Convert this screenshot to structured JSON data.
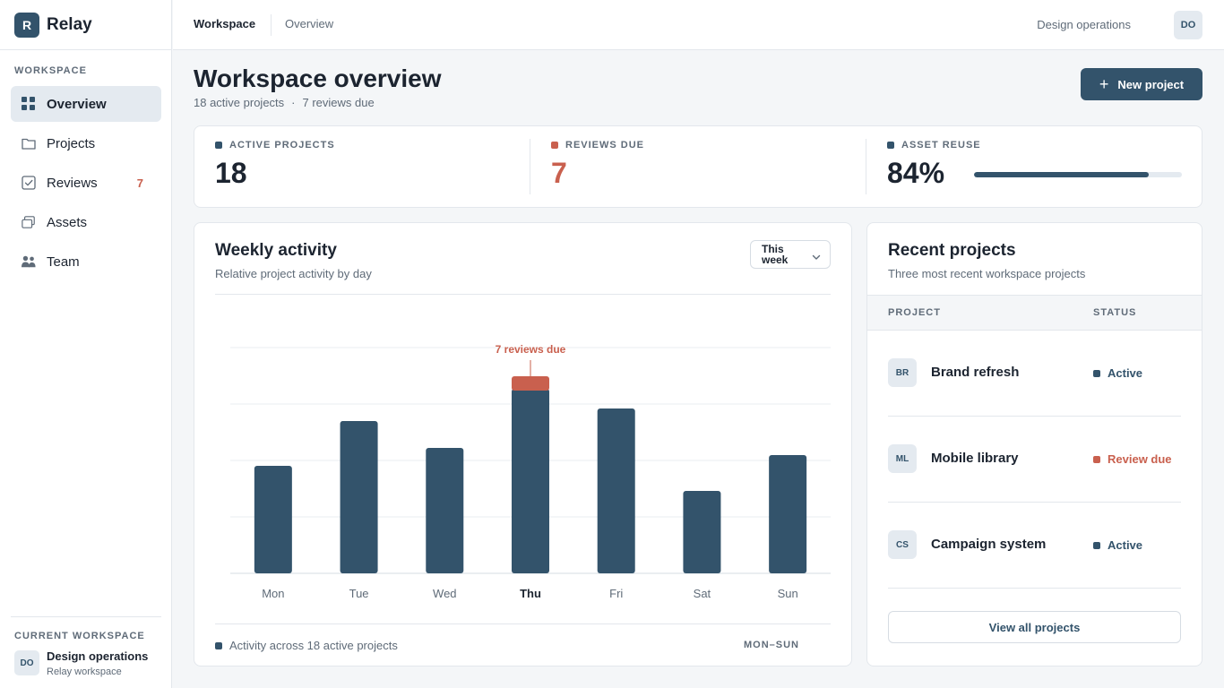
{
  "brand": {
    "logo_letter": "R",
    "name": "Relay"
  },
  "sidebar": {
    "section_label": "WORKSPACE",
    "items": [
      {
        "label": "Overview",
        "icon": "grid-icon",
        "active": true,
        "badge": ""
      },
      {
        "label": "Projects",
        "icon": "folder-icon",
        "active": false,
        "badge": ""
      },
      {
        "label": "Reviews",
        "icon": "checkbox-icon",
        "active": false,
        "badge": "7"
      },
      {
        "label": "Assets",
        "icon": "layers-icon",
        "active": false,
        "badge": ""
      },
      {
        "label": "Team",
        "icon": "people-icon",
        "active": false,
        "badge": ""
      }
    ],
    "current_workspace": {
      "label": "CURRENT WORKSPACE",
      "avatar": "DO",
      "name": "Design operations",
      "subtitle": "Relay workspace"
    }
  },
  "topbar": {
    "tabs": [
      "Workspace",
      "Overview"
    ],
    "org_name": "Design operations",
    "avatar": "DO"
  },
  "header": {
    "title": "Workspace overview",
    "subtitle_projects": "18 active projects",
    "subtitle_separator": "·",
    "subtitle_reviews": "7 reviews due",
    "new_project_label": "New project"
  },
  "stats": [
    {
      "label": "ACTIVE PROJECTS",
      "value": "18",
      "color": "#33536b"
    },
    {
      "label": "REVIEWS DUE",
      "value": "7",
      "color": "#c9604e"
    },
    {
      "label": "ASSET REUSE",
      "value": "84%",
      "color": "#33536b",
      "progress": 0.84
    }
  ],
  "activity": {
    "title": "Weekly activity",
    "subtitle": "Relative project activity by day",
    "range_select": "This week",
    "footer": "Activity across 18 active projects",
    "footer_range": "MON–SUN"
  },
  "chart_data": {
    "type": "bar",
    "categories": [
      "Mon",
      "Tue",
      "Wed",
      "Thu",
      "Fri",
      "Sat",
      "Sun"
    ],
    "series": [
      {
        "values": [
          60,
          85,
          70,
          103,
          92,
          46,
          66
        ],
        "color": "#33536b"
      },
      {
        "values": [
          0,
          0,
          0,
          7,
          0,
          0,
          0
        ],
        "color": "#c9604e"
      }
    ],
    "highlight_category": "Thu",
    "annotation": {
      "category": "Thu",
      "text": "7 reviews due",
      "color": "#c9604e"
    },
    "ylim": [
      0,
      126
    ],
    "grid": true
  },
  "recent": {
    "title": "Recent projects",
    "subtitle": "Three most recent workspace projects",
    "columns": [
      "PROJECT",
      "STATUS"
    ],
    "rows": [
      {
        "initials": "BR",
        "name": "Brand refresh",
        "status": "Active",
        "status_color": "#33536b"
      },
      {
        "initials": "ML",
        "name": "Mobile library",
        "status": "Review due",
        "status_color": "#c9604e"
      },
      {
        "initials": "CS",
        "name": "Campaign system",
        "status": "Active",
        "status_color": "#33536b"
      }
    ],
    "view_all_label": "View all projects"
  }
}
